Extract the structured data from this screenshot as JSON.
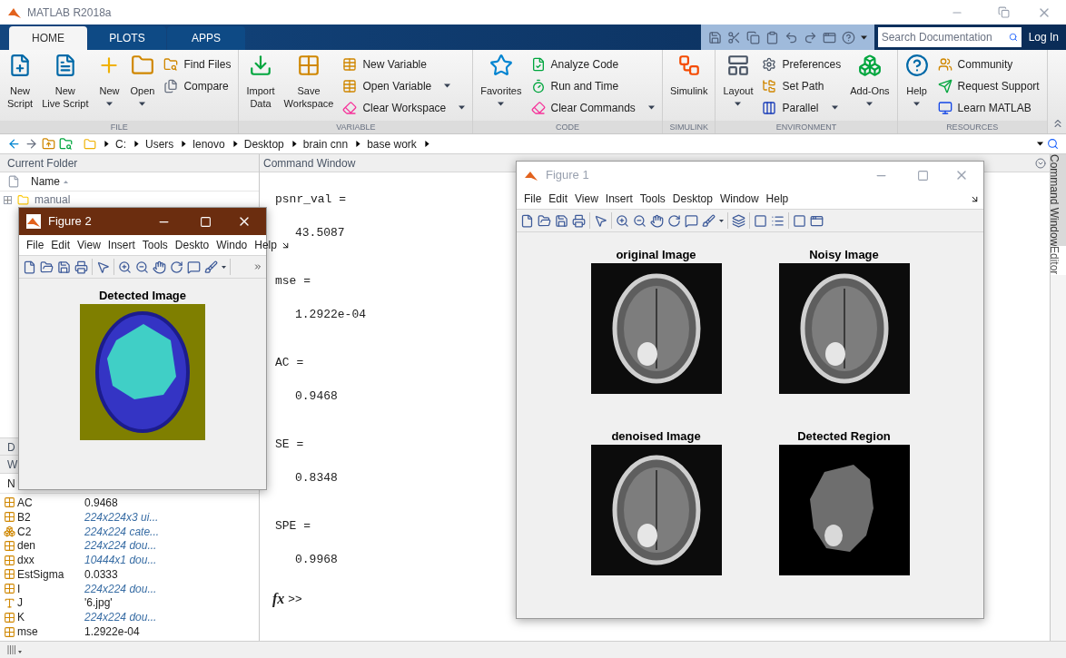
{
  "window": {
    "title": "MATLAB R2018a"
  },
  "ribbon_tabs": [
    {
      "label": "HOME",
      "selected": true
    },
    {
      "label": "PLOTS",
      "selected": false
    },
    {
      "label": "APPS",
      "selected": false
    }
  ],
  "search": {
    "placeholder": "Search Documentation"
  },
  "login": "Log In",
  "ribbon_sections": [
    {
      "label": "FILE",
      "items": [
        {
          "kind": "large",
          "lines": [
            "New",
            "Script"
          ],
          "dropdown": false
        },
        {
          "kind": "large",
          "lines": [
            "New",
            "Live Script"
          ],
          "dropdown": false
        },
        {
          "kind": "large",
          "lines": [
            "New"
          ],
          "dropdown": true
        },
        {
          "kind": "large",
          "lines": [
            "Open"
          ],
          "dropdown": true
        },
        {
          "kind": "stack",
          "items": [
            {
              "label": "Find Files",
              "dropdown": false
            },
            {
              "label": "Compare",
              "dropdown": false
            }
          ]
        }
      ]
    },
    {
      "label": "VARIABLE",
      "items": [
        {
          "kind": "large",
          "lines": [
            "Import",
            "Data"
          ],
          "dropdown": false
        },
        {
          "kind": "large",
          "lines": [
            "Save",
            "Workspace"
          ],
          "dropdown": false
        },
        {
          "kind": "stack",
          "items": [
            {
              "label": "New Variable",
              "dropdown": false
            },
            {
              "label": "Open Variable",
              "dropdown": true
            },
            {
              "label": "Clear Workspace",
              "dropdown": true
            }
          ]
        }
      ]
    },
    {
      "label": "CODE",
      "items": [
        {
          "kind": "large",
          "lines": [
            "Favorites"
          ],
          "dropdown": true
        },
        {
          "kind": "stack",
          "items": [
            {
              "label": "Analyze Code",
              "dropdown": false
            },
            {
              "label": "Run and Time",
              "dropdown": false
            },
            {
              "label": "Clear Commands",
              "dropdown": true
            }
          ]
        }
      ]
    },
    {
      "label": "SIMULINK",
      "items": [
        {
          "kind": "large",
          "lines": [
            "Simulink"
          ],
          "dropdown": false
        }
      ]
    },
    {
      "label": "ENVIRONMENT",
      "items": [
        {
          "kind": "large",
          "lines": [
            "Layout"
          ],
          "dropdown": true
        },
        {
          "kind": "stack",
          "items": [
            {
              "label": "Preferences",
              "dropdown": false
            },
            {
              "label": "Set Path",
              "dropdown": false
            },
            {
              "label": "Parallel",
              "dropdown": true
            }
          ]
        },
        {
          "kind": "large",
          "lines": [
            "Add-Ons"
          ],
          "dropdown": true
        }
      ]
    },
    {
      "label": "RESOURCES",
      "items": [
        {
          "kind": "large",
          "lines": [
            "Help"
          ],
          "dropdown": true
        },
        {
          "kind": "stack",
          "items": [
            {
              "label": "Community",
              "dropdown": false
            },
            {
              "label": "Request Support",
              "dropdown": false
            },
            {
              "label": "Learn MATLAB",
              "dropdown": false
            }
          ]
        }
      ]
    }
  ],
  "path": [
    "C:",
    "Users",
    "lenovo",
    "Desktop",
    "brain cnn",
    "base work"
  ],
  "current_folder": {
    "title": "Current Folder",
    "column": "Name",
    "items": [
      {
        "name": "manual",
        "expanded": false
      }
    ]
  },
  "details_header": "D",
  "workspace": {
    "header": "W",
    "column": "N",
    "rows": [
      {
        "name": "AC",
        "value": "0.9468",
        "kind": "scalar"
      },
      {
        "name": "B2",
        "value": "224x224x3 ui...",
        "kind": "matrix"
      },
      {
        "name": "C2",
        "value": "224x224 cate...",
        "kind": "categorical"
      },
      {
        "name": "den",
        "value": "224x224 dou...",
        "kind": "matrix"
      },
      {
        "name": "dxx",
        "value": "10444x1 dou...",
        "kind": "matrix"
      },
      {
        "name": "EstSigma",
        "value": "0.0333",
        "kind": "scalar"
      },
      {
        "name": "I",
        "value": "224x224 dou...",
        "kind": "matrix"
      },
      {
        "name": "J",
        "value": "'6.jpg'",
        "kind": "char"
      },
      {
        "name": "K",
        "value": "224x224 dou...",
        "kind": "matrix"
      },
      {
        "name": "mse",
        "value": "1.2922e-04",
        "kind": "scalar"
      }
    ]
  },
  "command_window": {
    "title": "Command Window",
    "lines": [
      {
        "kind": "name",
        "text": "psnr_val ="
      },
      {
        "kind": "value",
        "text": "43.5087"
      },
      {
        "kind": "name",
        "text": "mse ="
      },
      {
        "kind": "value",
        "text": "1.2922e-04"
      },
      {
        "kind": "name",
        "text": "AC ="
      },
      {
        "kind": "value",
        "text": "0.9468"
      },
      {
        "kind": "name",
        "text": "SE ="
      },
      {
        "kind": "value",
        "text": "0.8348"
      },
      {
        "kind": "name",
        "text": "SPE ="
      },
      {
        "kind": "value",
        "text": "0.9968"
      }
    ],
    "prompt_icon": "fx",
    "prompt": ">>"
  },
  "side_tabs": [
    {
      "label": "Command Window",
      "selected": true
    },
    {
      "label": "Editor",
      "selected": false
    }
  ],
  "figures": [
    {
      "title": "Figure 1",
      "active": false,
      "menu": [
        "File",
        "Edit",
        "View",
        "Insert",
        "Tools",
        "Desktop",
        "Window",
        "Help"
      ],
      "plots": [
        {
          "title": "original Image",
          "kind": "scan"
        },
        {
          "title": "Noisy Image",
          "kind": "scan"
        },
        {
          "title": "denoised Image",
          "kind": "scan"
        },
        {
          "title": "Detected Region",
          "kind": "region"
        }
      ]
    },
    {
      "title": "Figure 2",
      "active": true,
      "menu": [
        "File",
        "Edit",
        "View",
        "Insert",
        "Tools",
        "Deskto",
        "Windo",
        "Help"
      ],
      "plots": [
        {
          "title": "Detected Image",
          "kind": "segmented"
        }
      ]
    }
  ]
}
